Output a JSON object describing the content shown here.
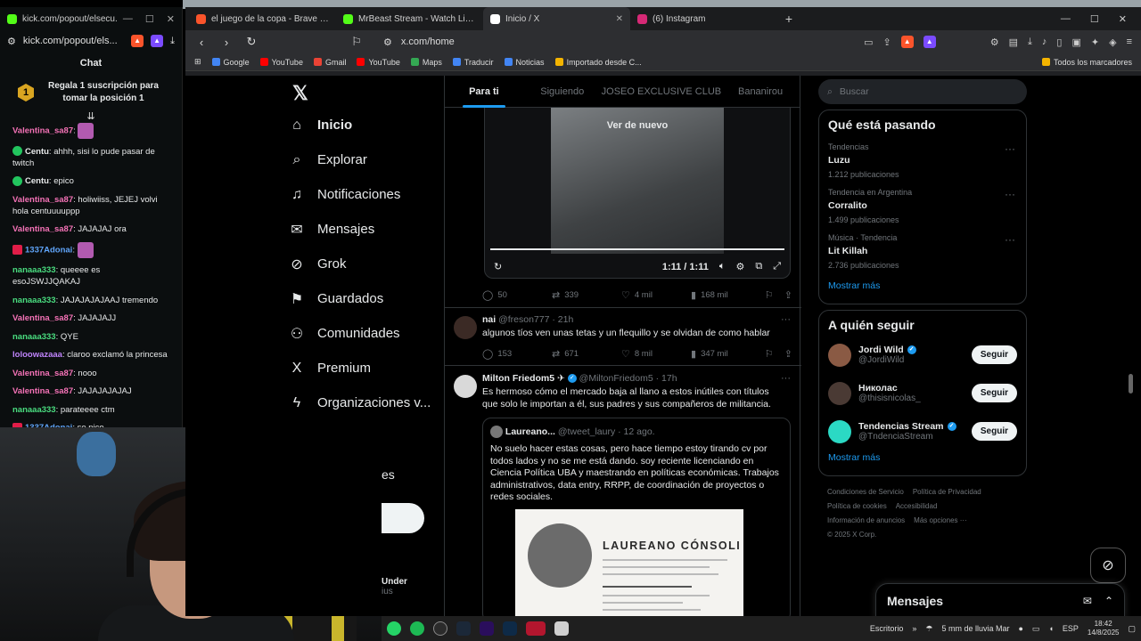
{
  "kick": {
    "window_title": "kick.com/popout/elsecu...",
    "url": "kick.com/popout/els...",
    "chat_title": "Chat",
    "promo_rank": "1",
    "promo_text": "Regala 1 suscripción para tomar la posición 1",
    "messages": [
      {
        "user": "Valentina_sa87",
        "text": "",
        "color": "#f472b6",
        "emote": true
      },
      {
        "user": "Centu",
        "text": "ahhh, sisi lo pude pasar de twitch",
        "color": "#e7e9ea",
        "badge": true
      },
      {
        "user": "Centu",
        "text": "epico",
        "color": "#e7e9ea",
        "badge": true
      },
      {
        "user": "Valentina_sa87",
        "text": "holiwiiss, JEJEJ volvi hola centuuuuppp",
        "color": "#f472b6"
      },
      {
        "user": "Valentina_sa87",
        "text": "JAJAJAJ ora",
        "color": "#f472b6"
      },
      {
        "user": "1337Adonai",
        "text": "",
        "color": "#60a5fa",
        "emote": true,
        "gift": true
      },
      {
        "user": "nanaaa333",
        "text": "queeee es esoJSWJJQAKAJ",
        "color": "#4ade80"
      },
      {
        "user": "nanaaa333",
        "text": "JAJAJAJAJAAJ tremendo",
        "color": "#4ade80"
      },
      {
        "user": "Valentina_sa87",
        "text": "JAJAJAJJ",
        "color": "#f472b6"
      },
      {
        "user": "nanaaa333",
        "text": "QYE",
        "color": "#4ade80"
      },
      {
        "user": "loloowazaaa",
        "text": "claroo exclamó la princesa",
        "color": "#c084fc"
      },
      {
        "user": "Valentina_sa87",
        "text": "nooo",
        "color": "#f472b6"
      },
      {
        "user": "Valentina_sa87",
        "text": "JAJAJAJAJAJ",
        "color": "#f472b6"
      },
      {
        "user": "nanaaa333",
        "text": "parateeee ctm",
        "color": "#4ade80"
      },
      {
        "user": "1337Adonai",
        "text": "se pico",
        "color": "#60a5fa",
        "gift": true
      }
    ]
  },
  "browser": {
    "tabs": [
      {
        "title": "el juego de la copa - Brave Search",
        "color": "#fb542b",
        "active": false
      },
      {
        "title": "MrBeast Stream - Watch Live on Kick",
        "color": "#53fc18",
        "active": false
      },
      {
        "title": "Inicio / X",
        "color": "#ffffff",
        "active": true
      },
      {
        "title": "(6) Instagram",
        "color": "#d62976",
        "active": false
      }
    ],
    "address": "x.com/home",
    "bookmarks": [
      {
        "label": "Google",
        "color": "#4285f4"
      },
      {
        "label": "YouTube",
        "color": "#ff0000"
      },
      {
        "label": "Gmail",
        "color": "#ea4335"
      },
      {
        "label": "YouTube",
        "color": "#ff0000"
      },
      {
        "label": "Maps",
        "color": "#34a853"
      },
      {
        "label": "Traducir",
        "color": "#4285f4"
      },
      {
        "label": "Noticias",
        "color": "#4285f4"
      },
      {
        "label": "Importado desde C...",
        "color": "#f4b400"
      }
    ],
    "bookmarks_right": "Todos los marcadores"
  },
  "x": {
    "nav": [
      {
        "label": "Inicio",
        "icon": "⌂",
        "name": "home"
      },
      {
        "label": "Explorar",
        "icon": "⌕",
        "name": "explore"
      },
      {
        "label": "Notificaciones",
        "icon": "♫",
        "name": "notifications"
      },
      {
        "label": "Mensajes",
        "icon": "✉",
        "name": "messages"
      },
      {
        "label": "Grok",
        "icon": "⊘",
        "name": "grok"
      },
      {
        "label": "Guardados",
        "icon": "⚑",
        "name": "bookmarks"
      },
      {
        "label": "Comunidades",
        "icon": "⚇",
        "name": "communities"
      },
      {
        "label": "Premium",
        "icon": "X",
        "name": "premium"
      },
      {
        "label": "Organizaciones v...",
        "icon": "ϟ",
        "name": "organizations"
      }
    ],
    "feed_tabs": [
      "Para ti",
      "Siguiendo",
      "JOSEO EXCLUSIVE CLUB",
      "Bananirou"
    ],
    "video": {
      "replay": "Ver de nuevo",
      "time": "1:11 / 1:11",
      "replies": "50",
      "reposts": "339",
      "likes": "4 mil",
      "views": "168 mil"
    },
    "tweet1": {
      "name": "nai",
      "handle": "@freson777 · 21h",
      "text": "algunos tíos ven unas tetas y un flequillo y se olvidan de como hablar",
      "replies": "153",
      "reposts": "671",
      "likes": "8 mil",
      "views": "347 mil"
    },
    "tweet2": {
      "name": "Milton Friedom5",
      "handle": "@MiltonFriedom5 · 17h",
      "text": "Es hermoso cómo el mercado baja al llano a estos inútiles con títulos que solo le importan a él, sus padres y sus compañeros de militancia.",
      "quote_name": "Laureano...",
      "quote_handle": "@tweet_laury · 12 ago.",
      "quote_text": "No suelo hacer estas cosas, pero hace tiempo estoy tirando cv por todos lados y no se me está dando. soy reciente licenciando en Ciencia Política UBA y maestrando en políticas económicas. Trabajos administrativos, data entry, RRPP, de coordinación de proyectos o redes sociales.",
      "cv_name": "LAUREANO CÓNSOLI"
    },
    "search_placeholder": "Buscar",
    "trending_title": "Qué está pasando",
    "trends": [
      {
        "context": "Tendencias",
        "name": "Luzu",
        "count": "1.212 publicaciones"
      },
      {
        "context": "Tendencia en Argentina",
        "name": "Corralito",
        "count": "1.499 publicaciones"
      },
      {
        "context": "Música · Tendencia",
        "name": "Lit Killah",
        "count": "2.736 publicaciones"
      }
    ],
    "show_more": "Mostrar más",
    "follow_title": "A quién seguir",
    "follow": [
      {
        "name": "Jordi Wild",
        "handle": "@JordiWild",
        "verified": true,
        "color": "#8a5a44"
      },
      {
        "name": "Николас",
        "handle": "@thisisnicolas_",
        "verified": false,
        "color": "#4a3a34"
      },
      {
        "name": "Tendencias Stream",
        "handle": "@TndenciaStream",
        "verified": true,
        "color": "#2bd9c4"
      }
    ],
    "follow_btn": "Seguir",
    "footer": [
      "Condiciones de Servicio",
      "Política de Privacidad",
      "Política de cookies",
      "Accesibilidad",
      "Información de anuncios",
      "Más opciones ···",
      "© 2025 X Corp."
    ],
    "messages_title": "Mensajes",
    "peek_es": "es",
    "peek_name": "Under",
    "peek_sub": "ius"
  },
  "taskbar": {
    "desk": "Escritorio",
    "weather": "5 mm de lluvia Mar",
    "lang": "ESP",
    "time": "18:42",
    "date": "14/8/2025"
  }
}
